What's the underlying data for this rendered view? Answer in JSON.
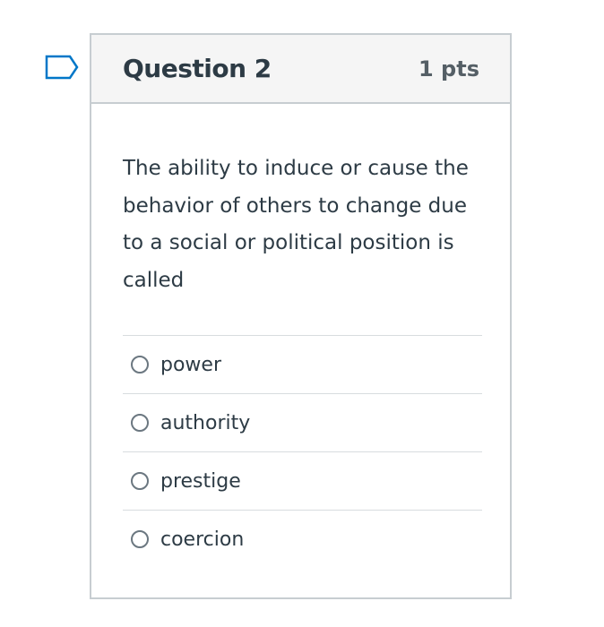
{
  "question": {
    "title": "Question 2",
    "points": "1 pts",
    "text": "The ability to induce or cause the behavior of others to change due to a social or political position is called",
    "flag_icon": "bookmark-flag-icon",
    "answers": [
      {
        "label": "power",
        "selected": false
      },
      {
        "label": "authority",
        "selected": false
      },
      {
        "label": "prestige",
        "selected": false
      },
      {
        "label": "coercion",
        "selected": false
      }
    ]
  },
  "colors": {
    "accent": "#0077c8",
    "text": "#2d3b45",
    "border": "#c7cdd1",
    "header_bg": "#f5f5f5"
  }
}
